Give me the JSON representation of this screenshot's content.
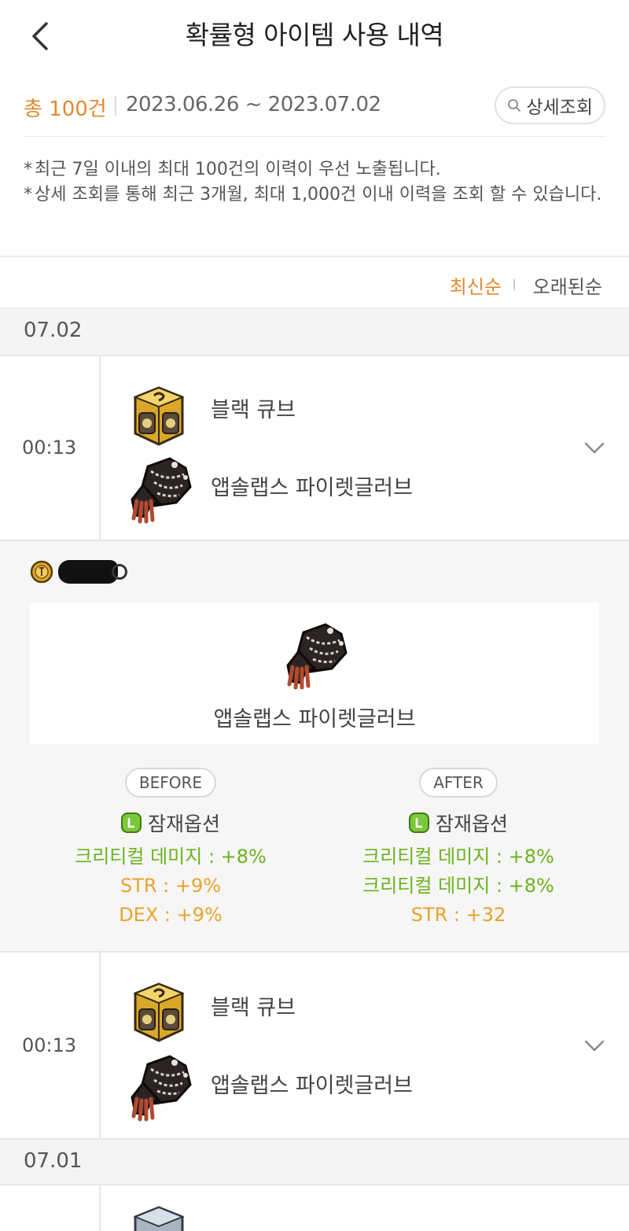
{
  "header": {
    "title": "확률형 아이템 사용 내역"
  },
  "summary": {
    "total": "총 100건",
    "date_range": "2023.06.26 ~ 2023.07.02",
    "detail_button": "상세조회"
  },
  "notice": [
    "최근 7일 이내의 최대 100건의 이력이 우선 노출됩니다.",
    "상세 조회를 통해 최근 3개월, 최대 1,000건 이내 이력을 조회 할 수 있습니다."
  ],
  "sort": {
    "newest": "최신순",
    "oldest": "오래된순",
    "active": "newest"
  },
  "groups": [
    {
      "date": "07.02",
      "entries": [
        {
          "time": "00:13",
          "cube": "블랙 큐브",
          "item": "앱솔랩스 파이렛글러브",
          "expanded": true,
          "detail": {
            "item": "앱솔랩스 파이렛글러브",
            "before": {
              "label": "BEFORE",
              "grade": "잠재옵션",
              "options": [
                "크리티컬 데미지 : +8%",
                "STR : +9%",
                "DEX : +9%"
              ]
            },
            "after": {
              "label": "AFTER",
              "grade": "잠재옵션",
              "options": [
                "크리티컬 데미지 : +8%",
                "크리티컬 데미지 : +8%",
                "STR : +32"
              ]
            }
          }
        },
        {
          "time": "00:13",
          "cube": "블랙 큐브",
          "item": "앱솔랩스 파이렛글러브",
          "expanded": false
        }
      ]
    },
    {
      "date": "07.01",
      "entries": [
        {
          "time": "",
          "cube": "",
          "item": "",
          "expanded": false
        }
      ]
    }
  ],
  "colors": {
    "accent": "#e08a2e",
    "legendary_option": "#6bb31e",
    "unique_option": "#e8a22c"
  }
}
